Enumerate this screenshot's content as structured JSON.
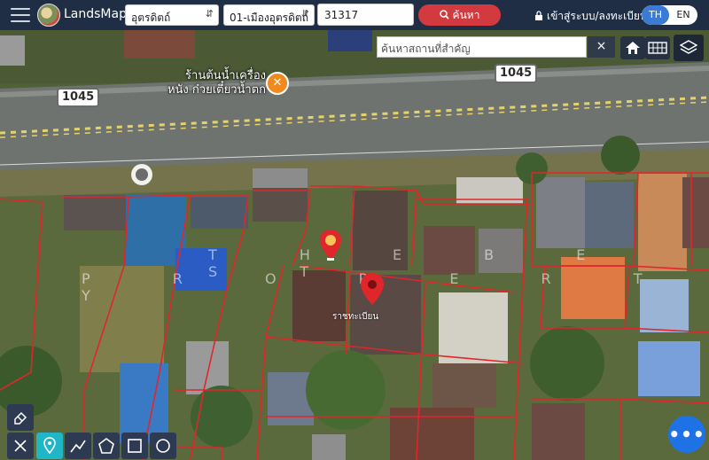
{
  "header": {
    "brand": "LandsMaps",
    "province": "อุตรดิตถ์",
    "district": "01-เมืองอุตรดิตถ์",
    "parcel_number": "31317",
    "search_label": "ค้นหา",
    "login_label": "เข้าสู่ระบบ/ลงทะเบียน",
    "lang_th": "TH",
    "lang_en": "EN"
  },
  "map_search": {
    "placeholder": "ค้นหาสถานที่สำคัญ",
    "clear": "×"
  },
  "map": {
    "road_shield_left": "1045",
    "road_shield_right": "1045",
    "poi_label_line1": "ร้านต้นน้ำเครื่อง",
    "poi_label_line2": "หนัง ก๋วยเตี๋ยวน้ำตก",
    "watermark_line1": "T H E B E S T",
    "watermark_line2": "P R O P E R T Y",
    "parcel_label": "ราชทะเบียน",
    "colors": {
      "parcel_border": "#e0262b",
      "marker_red": "#e0262b",
      "marker_orange": "#f5a623",
      "topbar": "#1f2e45",
      "search_button": "#d33a3f",
      "lang_active": "#3b7bd4",
      "fab": "#1e72e6"
    }
  },
  "icons": {
    "menu": "hamburger-icon",
    "search": "magnifier-icon",
    "login": "lock-icon",
    "home": "home-icon",
    "grid": "grid-icon",
    "layers": "layers-icon",
    "eraser": "eraser-icon",
    "ruler": "ruler-icon",
    "pin": "pin-icon",
    "polyline": "polyline-icon",
    "polygon": "polygon-icon",
    "rectangle": "rectangle-icon",
    "circle": "circle-icon",
    "more": "more-icon"
  }
}
